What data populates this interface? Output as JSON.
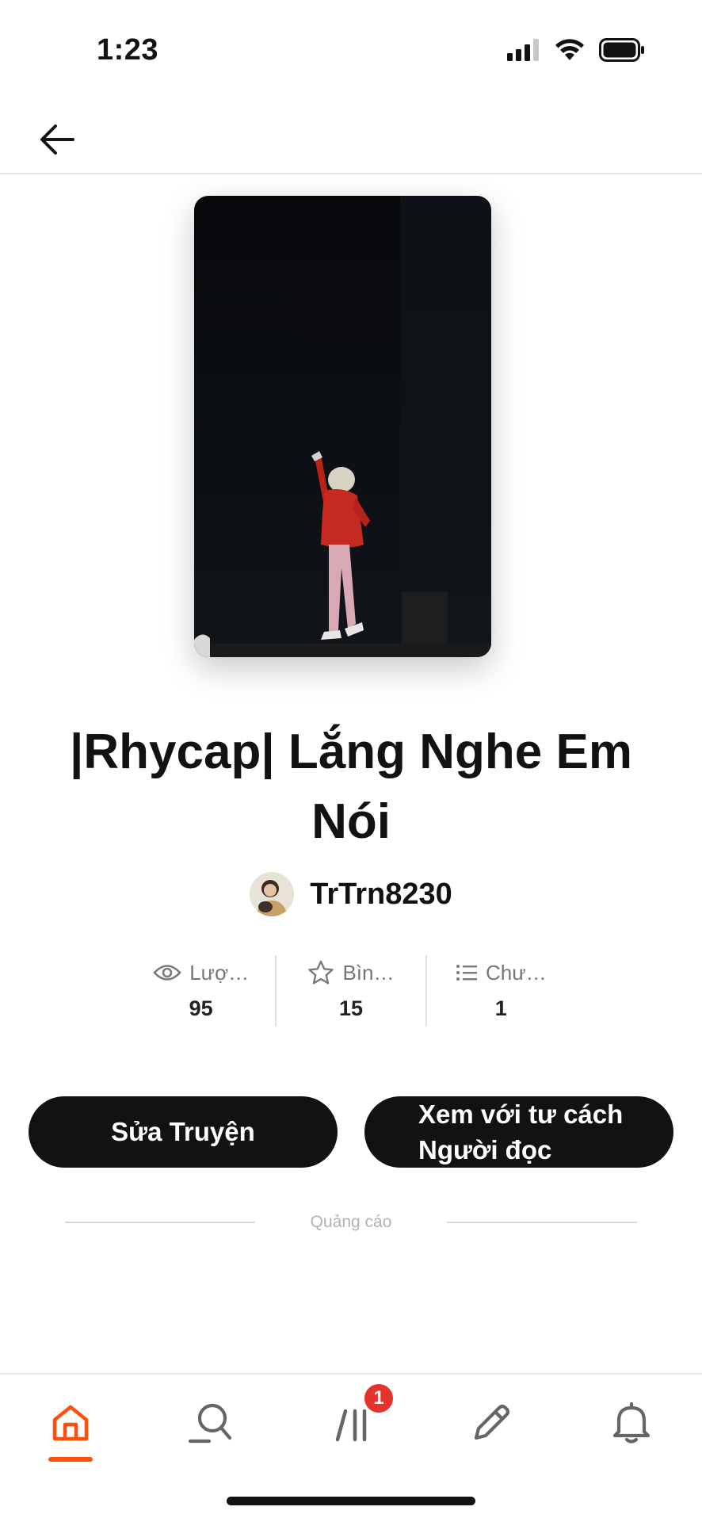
{
  "status_bar": {
    "time": "1:23"
  },
  "header": {
    "back_icon": "arrow-left-icon"
  },
  "story": {
    "title": "|Rhycap| Lắng Nghe Em Nói",
    "author": "TrTrn8230"
  },
  "stats": [
    {
      "icon": "eye-icon",
      "label": "Lượ…",
      "value": "95"
    },
    {
      "icon": "star-icon",
      "label": "Bìn…",
      "value": "15"
    },
    {
      "icon": "list-icon",
      "label": "Chư…",
      "value": "1"
    }
  ],
  "actions": {
    "edit_label": "Sửa Truyện",
    "view_label_line1": "Xem với tư cách",
    "view_label_line2": "Người đọc"
  },
  "ad": {
    "label": "Quảng cáo"
  },
  "bottom_nav": {
    "items": [
      "home-icon",
      "search-icon",
      "library-icon",
      "write-icon",
      "bell-icon"
    ],
    "badge": "1",
    "active_color": "#ff500a",
    "badge_color": "#e5322d"
  }
}
